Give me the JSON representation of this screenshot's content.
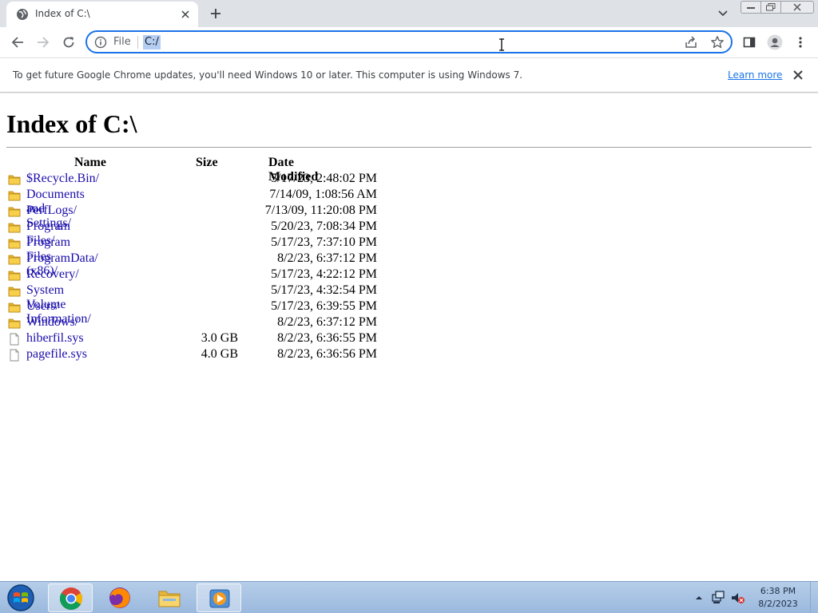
{
  "browser": {
    "tab": {
      "title": "Index of C:\\"
    },
    "omnibox": {
      "scheme": "File",
      "url": "C:/"
    },
    "icons": {
      "back": "arrow-left-icon",
      "forward": "arrow-right-icon",
      "reload": "reload-icon",
      "share": "share-icon",
      "bookmark": "star-icon",
      "side_panel": "side-panel-icon",
      "profile": "profile-icon",
      "menu": "kebab-menu-icon"
    }
  },
  "infobar": {
    "message": "To get future Google Chrome updates, you'll need Windows 10 or later. This computer is using Windows 7.",
    "link": "Learn more"
  },
  "page": {
    "heading": "Index of C:\\",
    "columns": {
      "name": "Name",
      "size": "Size",
      "date": "Date Modified"
    },
    "entries": [
      {
        "name": "$Recycle.Bin/",
        "size": "",
        "date": "5/17/23, 2:48:02 PM",
        "type": "folder"
      },
      {
        "name": "Documents and Settings/",
        "size": "",
        "date": "7/14/09, 1:08:56 AM",
        "type": "folder"
      },
      {
        "name": "PerfLogs/",
        "size": "",
        "date": "7/13/09, 11:20:08 PM",
        "type": "folder"
      },
      {
        "name": "Program Files/",
        "size": "",
        "date": "5/20/23, 7:08:34 PM",
        "type": "folder"
      },
      {
        "name": "Program Files (x86)/",
        "size": "",
        "date": "5/17/23, 7:37:10 PM",
        "type": "folder"
      },
      {
        "name": "ProgramData/",
        "size": "",
        "date": "8/2/23, 6:37:12 PM",
        "type": "folder"
      },
      {
        "name": "Recovery/",
        "size": "",
        "date": "5/17/23, 4:22:12 PM",
        "type": "folder"
      },
      {
        "name": "System Volume Information/",
        "size": "",
        "date": "5/17/23, 4:32:54 PM",
        "type": "folder"
      },
      {
        "name": "Users/",
        "size": "",
        "date": "5/17/23, 6:39:55 PM",
        "type": "folder"
      },
      {
        "name": "Windows/",
        "size": "",
        "date": "8/2/23, 6:37:12 PM",
        "type": "folder"
      },
      {
        "name": "hiberfil.sys",
        "size": "3.0 GB",
        "date": "8/2/23, 6:36:55 PM",
        "type": "file"
      },
      {
        "name": "pagefile.sys",
        "size": "4.0 GB",
        "date": "8/2/23, 6:36:56 PM",
        "type": "file"
      }
    ]
  },
  "taskbar": {
    "apps": [
      "chrome-icon",
      "firefox-icon",
      "file-explorer-icon",
      "media-player-icon"
    ],
    "clock": {
      "time": "6:38 PM",
      "date": "8/2/2023"
    }
  },
  "colors": {
    "accent": "#1a73e8",
    "link": "#1a0dab",
    "folder": "#f5c518"
  }
}
